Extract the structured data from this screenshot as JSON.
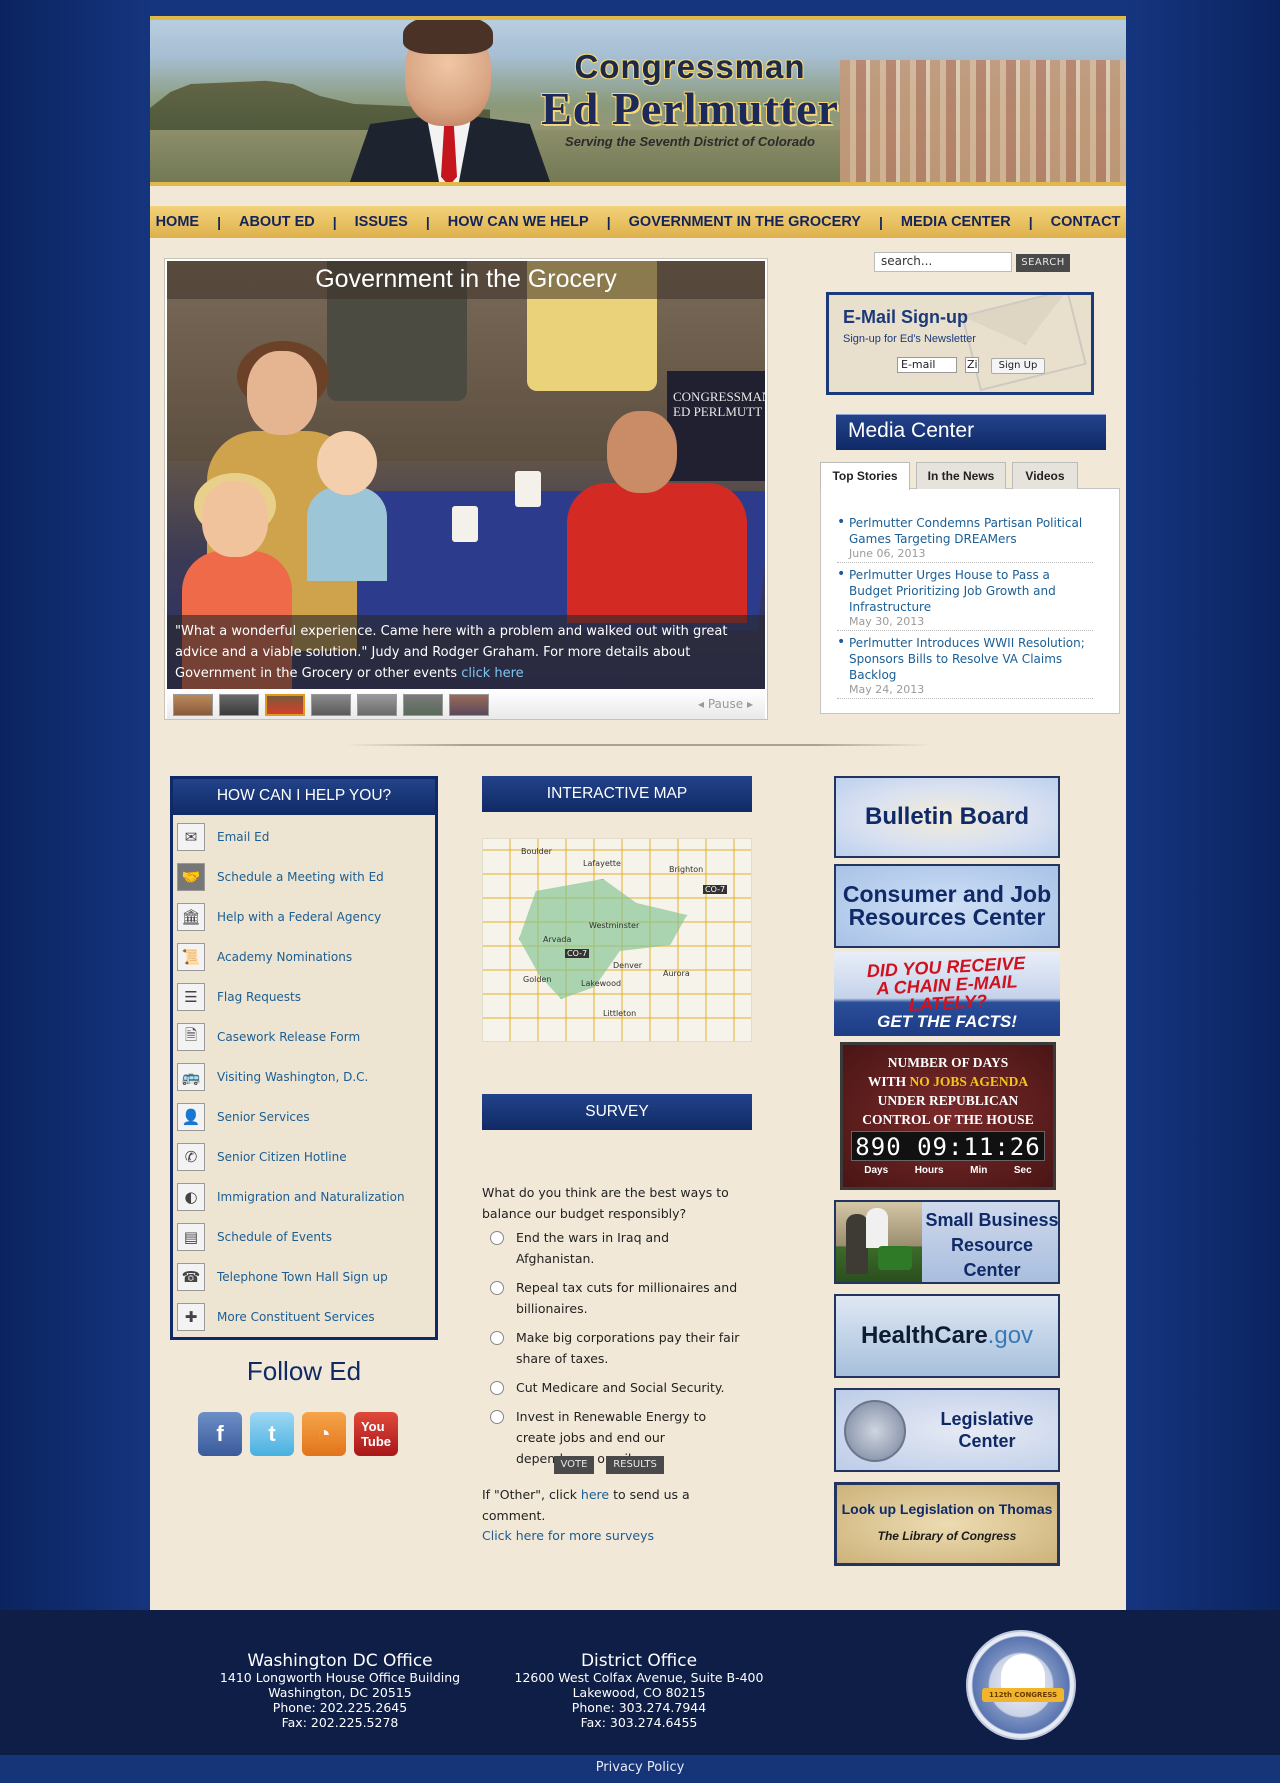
{
  "header": {
    "title_line1": "Congressman",
    "title_line2": "Ed Perlmutter",
    "tagline": "Serving the Seventh District of Colorado"
  },
  "nav": [
    "HOME",
    "ABOUT ED",
    "ISSUES",
    "HOW CAN WE HELP",
    "GOVERNMENT IN THE GROCERY",
    "MEDIA CENTER",
    "CONTACT"
  ],
  "slideshow": {
    "title": "Government in the Grocery",
    "banner_text": "CONGRESSMAN ED PERLMUTT",
    "caption": "\"What a wonderful experience. Came here with a problem and walked out with great advice and a viable solution.\" Judy and Rodger Graham. For more details about Government in the Grocery or other events",
    "caption_link": "click here",
    "pause_label": "Pause",
    "thumb_count": 7,
    "active_thumb": 3
  },
  "search": {
    "value": "search...",
    "button": "SEARCH"
  },
  "email_signup": {
    "title": "E-Mail Sign-up",
    "subtitle": "Sign-up for Ed's Newsletter",
    "email_value": "E-mail",
    "zip_value": "Zi",
    "button": "Sign Up"
  },
  "media_center": {
    "title": "Media Center",
    "tabs": [
      "Top Stories",
      "In the News",
      "Videos"
    ],
    "active_tab": "Top Stories",
    "stories": [
      {
        "title": "Perlmutter Condemns Partisan Political Games Targeting DREAMers",
        "date": "June 06, 2013"
      },
      {
        "title": "Perlmutter Urges House to Pass a Budget Prioritizing Job Growth and Infrastructure",
        "date": "May 30, 2013"
      },
      {
        "title": "Perlmutter Introduces WWII Resolution; Sponsors Bills to Resolve VA Claims Backlog",
        "date": "May 24, 2013"
      }
    ]
  },
  "help": {
    "title": "HOW CAN I HELP YOU?",
    "items": [
      {
        "label": "Email Ed",
        "icon": "envelope-icon"
      },
      {
        "label": "Schedule a Meeting with Ed",
        "icon": "handshake-icon"
      },
      {
        "label": "Help with a Federal Agency",
        "icon": "capitol-building-icon"
      },
      {
        "label": "Academy Nominations",
        "icon": "diploma-icon"
      },
      {
        "label": "Flag Requests",
        "icon": "flag-icon"
      },
      {
        "label": "Casework Release Form",
        "icon": "document-icon"
      },
      {
        "label": "Visiting Washington, D.C.",
        "icon": "bus-icon"
      },
      {
        "label": "Senior Services",
        "icon": "person-icon"
      },
      {
        "label": "Senior Citizen Hotline",
        "icon": "phone-icon"
      },
      {
        "label": "Immigration and Naturalization",
        "icon": "globe-icon"
      },
      {
        "label": "Schedule of Events",
        "icon": "calendar-icon"
      },
      {
        "label": "Telephone Town Hall Sign up",
        "icon": "telephone-icon"
      },
      {
        "label": "More Constituent Services",
        "icon": "plus-icon"
      }
    ]
  },
  "follow": {
    "title": "Follow Ed",
    "networks": [
      "facebook-icon",
      "twitter-icon",
      "rss-icon",
      "youtube-icon"
    ]
  },
  "map": {
    "title": "INTERACTIVE MAP",
    "labels": [
      "Boulder",
      "Lafayette",
      "Brighton",
      "Arvada",
      "Westminster",
      "Denver",
      "Aurora",
      "Lakewood",
      "Golden",
      "Littleton",
      "CO-7",
      "CO-7"
    ]
  },
  "survey": {
    "title": "SURVEY",
    "question": "What do you think are the best ways to balance our budget responsibly?",
    "options": [
      "End the wars in Iraq and Afghanistan.",
      "Repeal tax cuts for millionaires and billionaires.",
      "Make big corporations pay their fair share of taxes.",
      "Cut Medicare and Social Security.",
      "Invest in Renewable Energy to create jobs and end our dependence on oil."
    ],
    "vote_button": "VOTE",
    "results_button": "RESULTS",
    "other_prefix": "If \"Other\", click",
    "other_link": "here",
    "other_suffix": "to send us a comment.",
    "more_link": "Click here for more surveys"
  },
  "banners": {
    "bulletin": "Bulletin Board",
    "consumer": "Consumer and Job Resources Center",
    "chain_line1": "DID YOU RECEIVE",
    "chain_line2": "A CHAIN E-MAIL",
    "chain_line3": "LATELY?",
    "chain_bottom": "GET THE FACTS!",
    "days_line1": "NUMBER OF DAYS",
    "days_line2_a": "WITH",
    "days_line2_b": "NO JOBS AGENDA",
    "days_line3": "UNDER REPUBLICAN",
    "days_line4": "CONTROL OF THE HOUSE",
    "days_clock": "890 09:11:26",
    "days_labels": [
      "Days",
      "Hours",
      "Min",
      "Sec"
    ],
    "small_biz": "Small Business Resource Center",
    "health_main": "HealthCare",
    "health_suffix": ".gov",
    "legislative": "Legislative Center",
    "thomas_line1": "Look up Legislation on Thomas",
    "thomas_line2": "The Library of Congress"
  },
  "footer": {
    "dc": {
      "title": "Washington DC Office",
      "line1": "1410 Longworth House Office Building",
      "line2": "Washington, DC 20515",
      "phone": "Phone: 202.225.2645",
      "fax": "Fax: 202.225.5278"
    },
    "district": {
      "title": "District Office",
      "line1": "12600 West Colfax Avenue, Suite B-400",
      "line2": "Lakewood, CO 80215",
      "phone": "Phone: 303.274.7944",
      "fax": "Fax: 303.274.6455"
    },
    "badge_ribbon": "112th CONGRESS",
    "privacy": "Privacy Policy"
  },
  "colors": {
    "navy": "#0f2a66",
    "gold": "#deb14c",
    "cream": "#f1e8d7",
    "link": "#1b5e94"
  }
}
